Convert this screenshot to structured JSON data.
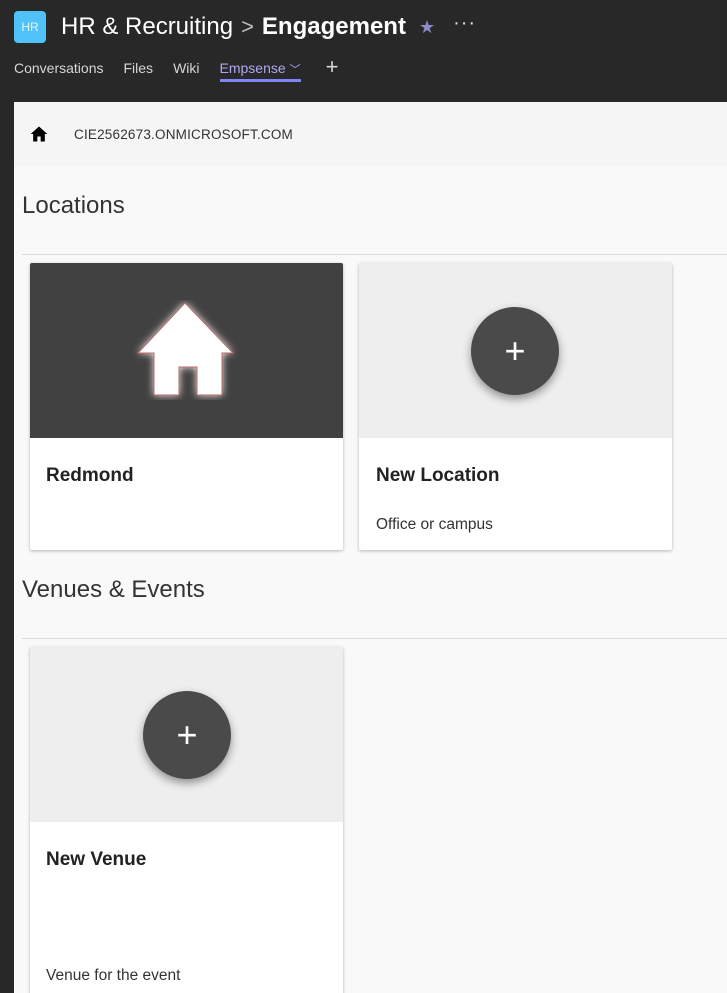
{
  "header": {
    "team_initials": "HR",
    "team_name": "HR & Recruiting",
    "separator": ">",
    "channel_name": "Engagement",
    "favorite_icon": "star-icon",
    "more_icon": "ellipsis-icon"
  },
  "tabs": [
    {
      "label": "Conversations"
    },
    {
      "label": "Files"
    },
    {
      "label": "Wiki"
    },
    {
      "label": "Empsense",
      "active": true
    }
  ],
  "colors": {
    "accent": "#7f85f5",
    "team_badge": "#4fc3f7",
    "card_dark": "#424141",
    "fab": "#4a4a4a"
  },
  "breadcrumb": {
    "tenant": "CIE2562673.ONMICROSOFT.COM"
  },
  "locations": {
    "title": "Locations",
    "cards": [
      {
        "title": "Redmond",
        "subtitle": ""
      },
      {
        "title": "New Location",
        "subtitle": "Office or campus"
      }
    ]
  },
  "venues": {
    "title": "Venues & Events",
    "cards": [
      {
        "title": "New Venue",
        "subtitle": "Venue for the event"
      }
    ]
  }
}
